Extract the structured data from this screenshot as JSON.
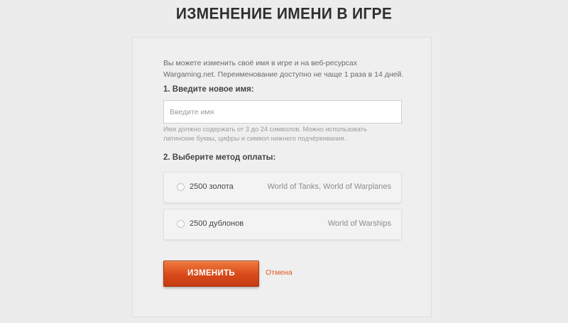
{
  "header": {
    "title": "ИЗМЕНЕНИЕ ИМЕНИ В ИГРЕ"
  },
  "form": {
    "intro_line1": "Вы можете изменить своё имя в игре и на веб-ресурсах",
    "intro_line2": "Wargaming.net. Переименование доступно не чаще 1 раза в 14 дней.",
    "step1_label": "1. Введите новое имя:",
    "name_input": {
      "value": "",
      "placeholder": "Введите имя"
    },
    "hint_line1": "Имя должно содержать от 3 до 24 символов. Можно использовать",
    "hint_line2": "латинские буквы, цифры и символ нижнего подчёркивания.",
    "step2_label": "2. Выберите метод оплаты:",
    "payment_options": [
      {
        "label": "2500 золота",
        "games": "World of Tanks, World of Warplanes",
        "selected": false
      },
      {
        "label": "2500 дублонов",
        "games": "World of Warships",
        "selected": false
      }
    ],
    "submit_label": "ИЗМЕНИТЬ",
    "cancel_label": "Отмена"
  },
  "colors": {
    "accent": "#d8491a",
    "link": "#e0561f",
    "background": "#ececec"
  }
}
